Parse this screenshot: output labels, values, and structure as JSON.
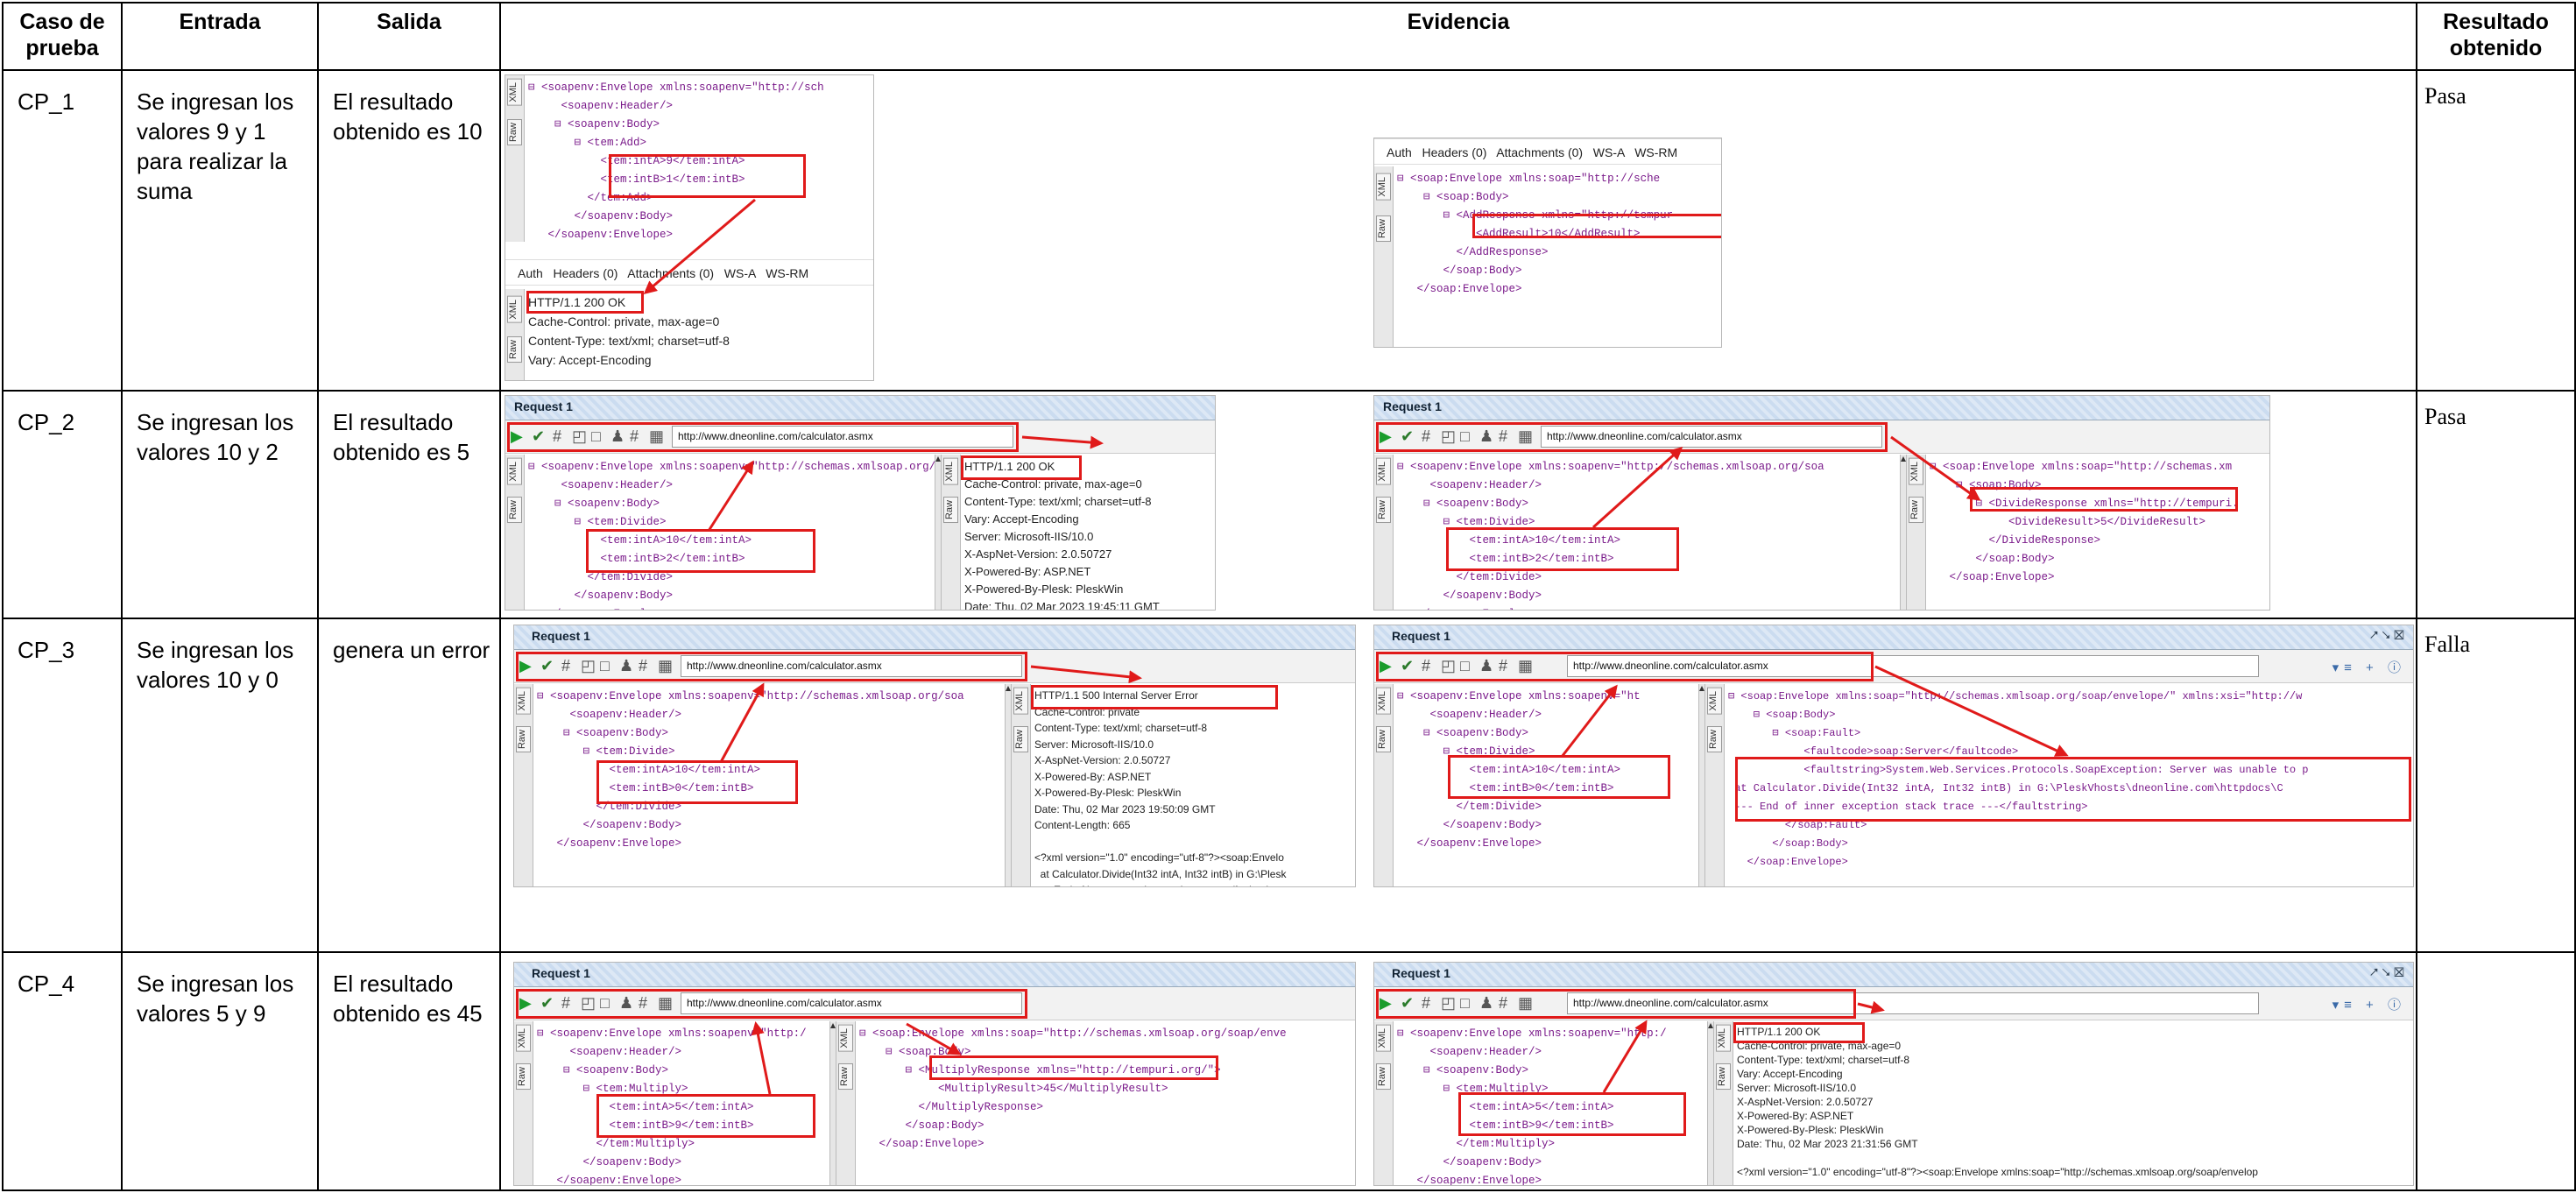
{
  "table": {
    "headers": [
      "Caso de prueba",
      "Entrada",
      "Salida",
      "Evidencia",
      "Resultado obtenido"
    ],
    "rows": [
      {
        "caso": "CP_1",
        "entrada": "Se ingresan los valores 9 y 1 para realizar la suma",
        "salida": "El resultado obtenido es 10",
        "resultado": "Pasa"
      },
      {
        "caso": "CP_2",
        "entrada": "Se ingresan los valores 10 y 2",
        "salida": "El resultado obtenido es 5",
        "resultado": "Pasa"
      },
      {
        "caso": "CP_3",
        "entrada": "Se ingresan los valores 10 y 0",
        "salida": "genera un error",
        "resultado": "Falla"
      },
      {
        "caso": "CP_4",
        "entrada": "Se ingresan los valores 5 y 9",
        "salida": "El resultado obtenido es 45",
        "resultado": ""
      }
    ]
  },
  "common": {
    "request_title": "Request 1",
    "url": "http://www.dneonline.com/calculator.asmx",
    "tabs_line": "Auth   Headers (0)   Attachments (0)   WS-A   WS-RM",
    "tab_xml": "XML",
    "tab_raw": "Raw",
    "win_controls": "⭧⭨☒",
    "right_tools": "▾≡ + ⓘ"
  },
  "cp1": {
    "req_xml": "⊟ <soapenv:Envelope xmlns:soapenv=\"http://sch\n     <soapenv:Header/>\n    ⊟ <soapenv:Body>\n       ⊟ <tem:Add>\n           <tem:intA>9</tem:intA>\n           <tem:intB>1</tem:intB>\n         </tem:Add>\n       </soapenv:Body>\n   </soapenv:Envelope>",
    "resp_headers": "HTTP/1.1 200 OK\nCache-Control: private, max-age=0\nContent-Type: text/xml; charset=utf-8\nVary: Accept-Encoding",
    "resp_xml": "⊟ <soap:Envelope xmlns:soap=\"http://sche\n    ⊟ <soap:Body>\n       ⊟ <AddResponse xmlns=\"http://tempur\n            <AddResult>10</AddResult>\n         </AddResponse>\n       </soap:Body>\n   </soap:Envelope>"
  },
  "cp2": {
    "req_xml": "⊟ <soapenv:Envelope xmlns:soapenv=\"http://schemas.xmlsoap.org/soa\n     <soapenv:Header/>\n    ⊟ <soapenv:Body>\n       ⊟ <tem:Divide>\n           <tem:intA>10</tem:intA>\n           <tem:intB>2</tem:intB>\n         </tem:Divide>\n       </soapenv:Body>\n   </soapenv:Envelope>",
    "resp_headers": "HTTP/1.1 200 OK\nCache-Control: private, max-age=0\nContent-Type: text/xml; charset=utf-8\nVary: Accept-Encoding\nServer: Microsoft-IIS/10.0\nX-AspNet-Version: 2.0.50727\nX-Powered-By: ASP.NET\nX-Powered-By-Plesk: PleskWin\nDate: Thu, 02 Mar 2023 19:45:11 GMT",
    "req_xml_b": "⊟ <soapenv:Envelope xmlns:soapenv=\"http://schemas.xmlsoap.org/soa\n     <soapenv:Header/>\n    ⊟ <soapenv:Body>\n       ⊟ <tem:Divide>\n           <tem:intA>10</tem:intA>\n           <tem:intB>2</tem:intB>\n         </tem:Divide>\n       </soapenv:Body>\n   </soapenv:Envelope>",
    "resp_xml": "⊟ <soap:Envelope xmlns:soap=\"http://schemas.xm\n    ⊟ <soap:Body>\n       ⊟ <DivideResponse xmlns=\"http://tempuri.\n            <DivideResult>5</DivideResult>\n         </DivideResponse>\n       </soap:Body>\n   </soap:Envelope>"
  },
  "cp3": {
    "req_xml": "⊟ <soapenv:Envelope xmlns:soapenv=\"http://schemas.xmlsoap.org/soa\n     <soapenv:Header/>\n    ⊟ <soapenv:Body>\n       ⊟ <tem:Divide>\n           <tem:intA>10</tem:intA>\n           <tem:intB>0</tem:intB>\n         </tem:Divide>\n       </soapenv:Body>\n   </soapenv:Envelope>",
    "resp_headers": "HTTP/1.1 500 Internal Server Error\nCache-Control: private\nContent-Type: text/xml; charset=utf-8\nServer: Microsoft-IIS/10.0\nX-AspNet-Version: 2.0.50727\nX-Powered-By: ASP.NET\nX-Powered-By-Plesk: PleskWin\nDate: Thu, 02 Mar 2023 19:50:09 GMT\nContent-Length: 665\n\n<?xml version=\"1.0\" encoding=\"utf-8\"?><soap:Envelo\n  at Calculator.Divide(Int32 intA, Int32 intB) in G:\\Plesk\n  --- End of inner exception stack trace ---</faultstring",
    "req_xml_b": "⊟ <soapenv:Envelope xmlns:soapenv=\"ht\n     <soapenv:Header/>\n    ⊟ <soapenv:Body>\n       ⊟ <tem:Divide>\n           <tem:intA>10</tem:intA>\n           <tem:intB>0</tem:intB>\n         </tem:Divide>\n       </soapenv:Body>\n   </soapenv:Envelope>",
    "resp_xml": "⊟ <soap:Envelope xmlns:soap=\"http://schemas.xmlsoap.org/soap/envelope/\" xmlns:xsi=\"http://w\n    ⊟ <soap:Body>\n       ⊟ <soap:Fault>\n            <faultcode>soap:Server</faultcode>\n            <faultstring>System.Web.Services.Protocols.SoapException: Server was unable to p\n at Calculator.Divide(Int32 intA, Int32 intB) in G:\\PleskVhosts\\dneonline.com\\httpdocs\\C\n --- End of inner exception stack trace ---</faultstring>\n         </soap:Fault>\n       </soap:Body>\n   </soap:Envelope>"
  },
  "cp4": {
    "req_xml": "⊟ <soapenv:Envelope xmlns:soapenv=\"http:/\n     <soapenv:Header/>\n    ⊟ <soapenv:Body>\n       ⊟ <tem:Multiply>\n           <tem:intA>5</tem:intA>\n           <tem:intB>9</tem:intB>\n         </tem:Multiply>\n       </soapenv:Body>\n   </soapenv:Envelope>",
    "resp_xml": "⊟ <soap:Envelope xmlns:soap=\"http://schemas.xmlsoap.org/soap/enve\n    ⊟ <soap:Body>\n       ⊟ <MultiplyResponse xmlns=\"http://tempuri.org/\">\n            <MultiplyResult>45</MultiplyResult>\n         </MultiplyResponse>\n       </soap:Body>\n   </soap:Envelope>",
    "req_xml_b": "⊟ <soapenv:Envelope xmlns:soapenv=\"http:/\n     <soapenv:Header/>\n    ⊟ <soapenv:Body>\n       ⊟ <tem:Multiply>\n           <tem:intA>5</tem:intA>\n           <tem:intB>9</tem:intB>\n         </tem:Multiply>\n       </soapenv:Body>\n   </soapenv:Envelope>",
    "resp_headers": "HTTP/1.1 200 OK\nCache-Control: private, max-age=0\nContent-Type: text/xml; charset=utf-8\nVary: Accept-Encoding\nServer: Microsoft-IIS/10.0\nX-AspNet-Version: 2.0.50727\nX-Powered-By: ASP.NET\nX-Powered-By-Plesk: PleskWin\nDate: Thu, 02 Mar 2023 21:31:56 GMT\n\n<?xml version=\"1.0\" encoding=\"utf-8\"?><soap:Envelope xmlns:soap=\"http://schemas.xmlsoap.org/soap/envelop"
  }
}
